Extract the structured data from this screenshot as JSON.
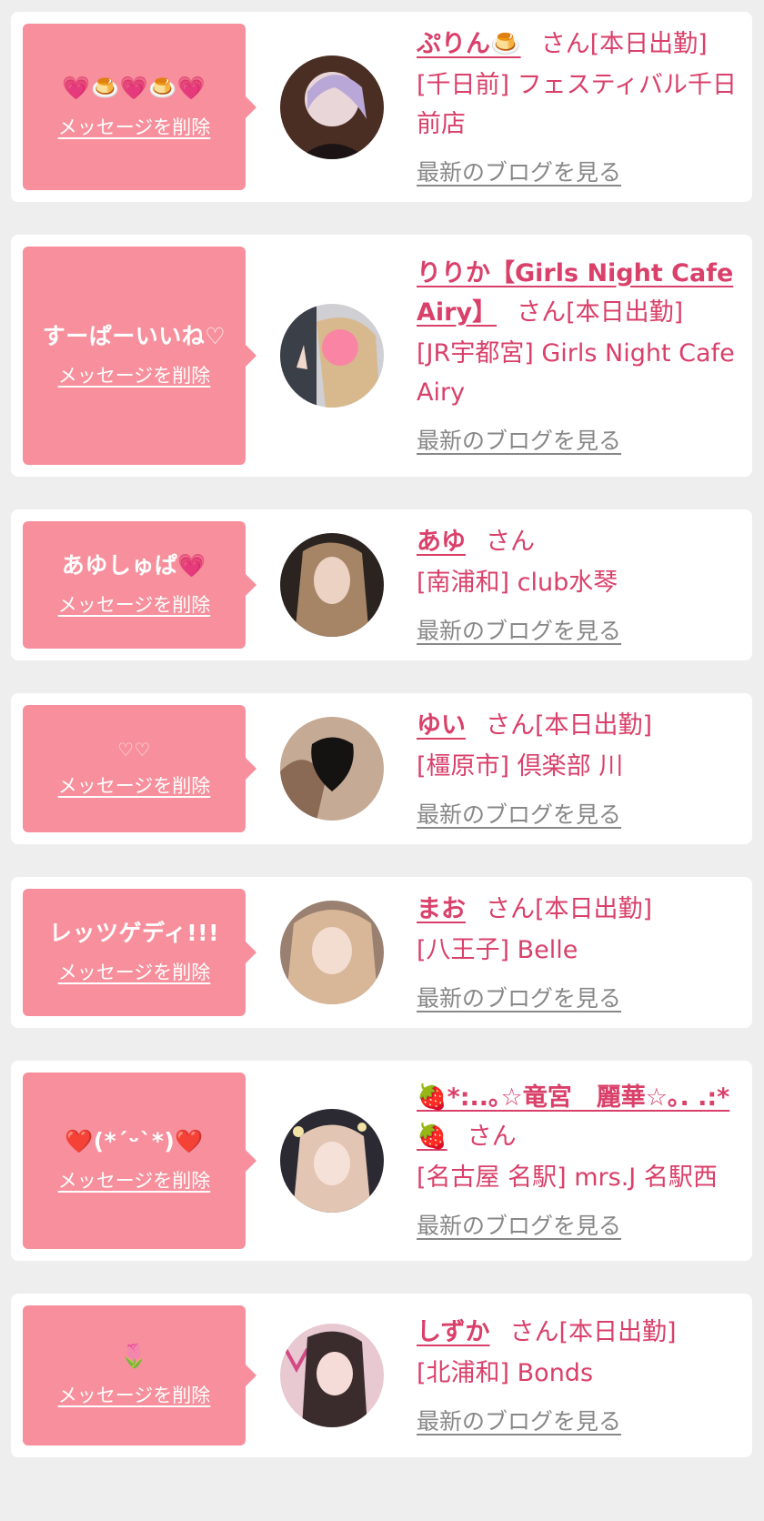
{
  "cards": [
    {
      "message": "💗🍮💗🍮💗",
      "delete_label": "メッセージを削除",
      "name": "ぷりん🍮",
      "honorific": "さん[本日出勤]",
      "shop": "[千日前] フェスティバル千日前店",
      "blog_label": "最新のブログを見る"
    },
    {
      "message": "すーぱーいいね♡",
      "delete_label": "メッセージを削除",
      "name": "りりか【Girls Night Cafe Airy】",
      "honorific": "さん[本日出勤]",
      "shop": "[JR宇都宮] Girls Night Cafe Airy",
      "blog_label": "最新のブログを見る"
    },
    {
      "message": "あゆしゅぱ💗",
      "delete_label": "メッセージを削除",
      "name": "あゆ",
      "honorific": "さん",
      "shop": "[南浦和] club水琴",
      "blog_label": "最新のブログを見る"
    },
    {
      "message": "♡♡",
      "delete_label": "メッセージを削除",
      "name": "ゆい",
      "honorific": "さん[本日出勤]",
      "shop": "[橿原市] 倶楽部 川",
      "blog_label": "最新のブログを見る"
    },
    {
      "message": "レッツゲディ!!!",
      "delete_label": "メッセージを削除",
      "name": "まお",
      "honorific": "さん[本日出勤]",
      "shop": "[八王子] Belle",
      "blog_label": "最新のブログを見る"
    },
    {
      "message": "❤️(*´ᵕ`*)❤️",
      "delete_label": "メッセージを削除",
      "name": "🍓*:..｡☆竜宮　麗華☆｡. .:*🍓",
      "honorific": "さん",
      "shop": "[名古屋 名駅] mrs.J 名駅西",
      "blog_label": "最新のブログを見る"
    },
    {
      "message": "🌷",
      "delete_label": "メッセージを削除",
      "name": "しずか",
      "honorific": "さん[本日出勤]",
      "shop": "[北浦和] Bonds",
      "blog_label": "最新のブログを見る"
    }
  ],
  "colors": {
    "bubble": "#f7909c",
    "accent_text": "#d9406a",
    "blog_link": "#888888",
    "page_background": "#eeeeee"
  }
}
